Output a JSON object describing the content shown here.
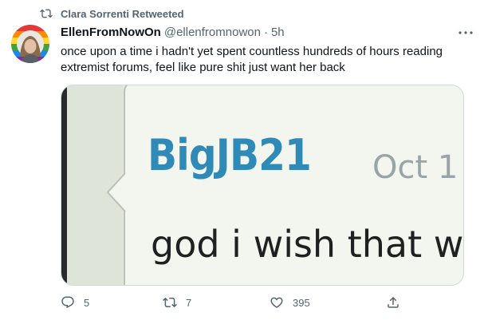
{
  "retweet_banner": {
    "text": "Clara Sorrenti Retweeted"
  },
  "tweet": {
    "display_name": "EllenFromNowOn",
    "handle": "@ellenfromnowon",
    "separator": "·",
    "time": "5h",
    "text": "once upon a time i hadn't yet spent countless hundreds of hours reading extremist forums, feel like pure shit just want her back",
    "media": {
      "username": "BigJB21",
      "date": "Oct 1",
      "message": "god i wish that w"
    },
    "actions": {
      "replies": "5",
      "retweets": "7",
      "likes": "395"
    }
  },
  "colors": {
    "secondary_text": "#536471",
    "media_username": "#2f8ab7"
  }
}
